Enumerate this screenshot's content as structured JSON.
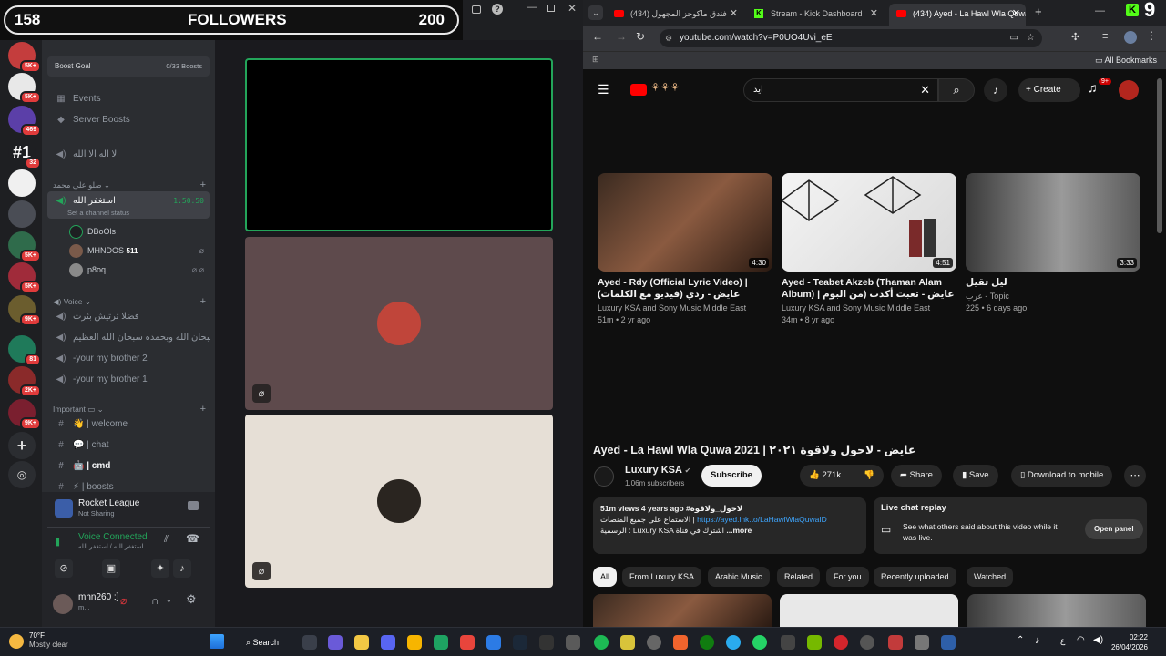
{
  "followers": {
    "left": "158",
    "label": "FOLLOWERS",
    "right": "200"
  },
  "servers": [
    {
      "label": "",
      "badge": "5K+"
    },
    {
      "label": "",
      "badge": "5K+"
    },
    {
      "label": "",
      "badge": "469"
    },
    {
      "label": "#1",
      "badge": "32"
    },
    {
      "label": "",
      "badge": ""
    },
    {
      "label": "",
      "badge": ""
    },
    {
      "label": "",
      "badge": "5K+"
    },
    {
      "label": "",
      "badge": "5K+"
    },
    {
      "label": "",
      "badge": "9K+"
    },
    {
      "label": "",
      "badge": "81"
    },
    {
      "label": "",
      "badge": "2K+"
    },
    {
      "label": "",
      "badge": "9K+"
    },
    {
      "label": "",
      "badge": "5K+"
    }
  ],
  "channels": {
    "boost_goal": "Boost Goal",
    "boost_count": "0/33 Boosts",
    "events": "Events",
    "server_boosts": "Server Boosts",
    "voice1": "لا اله الا الله",
    "cat1": "صلو على محمد",
    "active_voice": "استغفر الله",
    "active_time": "1:50:50",
    "set_status": "Set a channel status",
    "users": [
      {
        "name": "DBoOls",
        "badge": ""
      },
      {
        "name": "MHNDOS",
        "badge": "511"
      },
      {
        "name": "p8oq",
        "badge": ""
      }
    ],
    "cat_voice": "Voice",
    "voice_channels": [
      "فضلا ترتيش بثرث",
      "سبحان الله وبحمده سبحان الله العظيم",
      "-your my brother 2",
      "-your my brother 1"
    ],
    "cat_important": "Important",
    "text_channels": [
      "| welcome",
      "| chat",
      "| cmd",
      "| boosts"
    ]
  },
  "panel": {
    "activity": "Rocket League",
    "activity_sub": "Not Sharing",
    "voice_status": "Voice Connected",
    "voice_sub": "استغفر الله / استغفر الله",
    "username": "mhn260 :]",
    "user_sub": "m..."
  },
  "chrome": {
    "tabs": [
      {
        "title": "(434) فندق ماكوجز المجهول",
        "color": "#ff0000"
      },
      {
        "title": "Stream - Kick Dashboard",
        "color": "#53fc18"
      },
      {
        "title": "(434) Ayed - La Hawl Wla Quwa",
        "color": "#ff0000"
      }
    ],
    "url": "youtube.com/watch?v=P0UO4Uvi_eE",
    "bookmarks": "All Bookmarks"
  },
  "youtube": {
    "search_value": "ايد",
    "create": "Create",
    "notif_badge": "9+",
    "cards": [
      {
        "title": "Ayed - Rdy (Official Lyric Video) | عايض - ردي (فيديو مع الكلمات)",
        "channel": "Luxury KSA and Sony Music Middle East",
        "meta": "51m • 2 yr ago",
        "duration": "4:30"
      },
      {
        "title": "Ayed - Teabet Akzeb (Thaman Alam Album) | عايض - تعبت أكذب (من البوم ثمان الام)",
        "channel": "Luxury KSA and Sony Music Middle East",
        "meta": "34m • 8 yr ago",
        "duration": "4:51"
      },
      {
        "title": "ليل تقيل",
        "channel": "عرب - Topic",
        "meta": "225 • 6 days ago",
        "duration": "3:33"
      }
    ],
    "video_title": "Ayed - La Hawl Wla Quwa 2021 | عايض - لاحول ولاقوة ٢٠٢١",
    "channel_name": "Luxury KSA",
    "subscribers": "1.06m subscribers",
    "subscribe": "Subscribe",
    "likes": "271k",
    "share": "Share",
    "save": "Save",
    "download": "Download to mobile",
    "desc_meta": "51m views  4 years ago  #لاحول_ولاقوة",
    "desc_line1": "الاستماع على جميع المنصات |",
    "desc_link": "https://ayed.lnk.to/LaHawlWlaQuwaID",
    "desc_line2": "الرسمية : Luxury KSA اشترك في قناة",
    "desc_more": "...more",
    "live_title": "Live chat replay",
    "live_text": "See what others said about this video while it was live.",
    "open_panel": "Open panel",
    "chips": [
      "All",
      "From Luxury KSA",
      "Arabic Music",
      "Related",
      "For you",
      "Recently uploaded",
      "Watched"
    ]
  },
  "taskbar": {
    "weather_temp": "70°F",
    "weather_text": "Mostly clear",
    "search": "Search",
    "time": "02:22",
    "date": "26/04/2026"
  }
}
